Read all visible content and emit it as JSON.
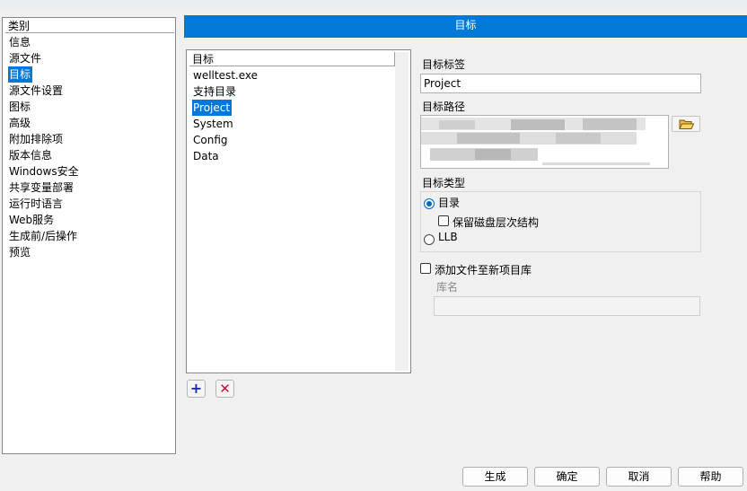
{
  "title": "目标",
  "categories": {
    "header": "类别",
    "items": [
      "信息",
      "源文件",
      "目标",
      "源文件设置",
      "图标",
      "高级",
      "附加排除项",
      "版本信息",
      "Windows安全",
      "共享变量部署",
      "运行时语言",
      "Web服务",
      "生成前/后操作",
      "预览"
    ],
    "selected_index": 2
  },
  "targets": {
    "header": "目标",
    "items": [
      "welltest.exe",
      "支持目录",
      "Project",
      "System",
      "Config",
      "Data"
    ],
    "selected_index": 2
  },
  "form": {
    "target_label_caption": "目标标签",
    "target_label_value": "Project",
    "target_path_caption": "目标路径",
    "target_type_caption": "目标类型",
    "radio_directory": "目录",
    "check_preserve_hierarchy": "保留磁盘层次结构",
    "radio_llb": "LLB",
    "check_add_to_library": "添加文件至新项目库",
    "library_name_caption": "库名",
    "library_name_value": ""
  },
  "buttons": {
    "build": "生成",
    "ok": "确定",
    "cancel": "取消",
    "help": "帮助"
  },
  "icons": {
    "add": "+",
    "remove": "✕"
  },
  "colors": {
    "accent": "#0078d7"
  }
}
